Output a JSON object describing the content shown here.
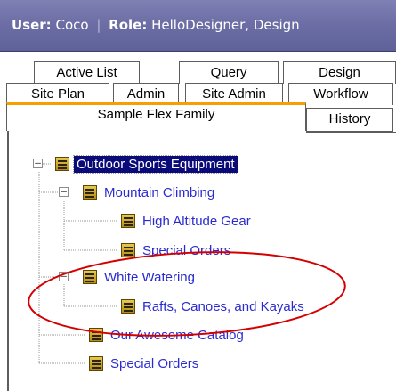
{
  "header": {
    "user_label": "User:",
    "user_value": "Coco",
    "separator": "|",
    "role_label": "Role:",
    "role_value": "HelloDesigner, Design"
  },
  "tabs": {
    "row1": [
      "Active List",
      "Query",
      "Design"
    ],
    "row2": [
      "Site Plan",
      "Admin",
      "Site Admin",
      "Workflow"
    ],
    "row3": [
      "Sample Flex Family",
      "History"
    ],
    "active": "Sample Flex Family"
  },
  "tree": {
    "root": "Outdoor Sports Equipment",
    "mountain": "Mountain Climbing",
    "high_altitude": "High Altitude Gear",
    "special_orders_child": "Special Orders",
    "white_watering": "White Watering",
    "rafts": "Rafts, Canoes, and Kayaks",
    "catalog": "Our Awesome Catalog",
    "special_orders": "Special Orders",
    "expanded_glyph": "–"
  },
  "colors": {
    "header_bg": "#6c6ea5",
    "active_tab_accent": "#f5a000",
    "link": "#2a2ad0",
    "selected_bg": "#0a0a78",
    "highlight_oval": "#d40000"
  }
}
